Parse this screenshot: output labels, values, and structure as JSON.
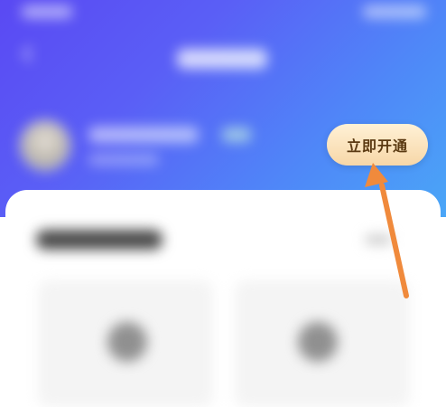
{
  "vip_header": {
    "open_button_label": "立即开通"
  },
  "annotation": {
    "arrow_color": "#f08a3c"
  },
  "colors": {
    "header_gradient_start": "#5a49f3",
    "header_gradient_end": "#4aa6f7",
    "button_text": "#5b3a12",
    "button_bg_top": "#fff1d6",
    "button_bg_bottom": "#f7d7a8"
  }
}
